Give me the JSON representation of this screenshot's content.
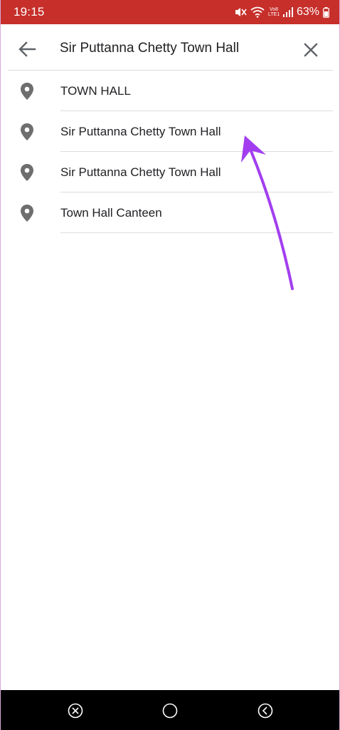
{
  "status_bar": {
    "time": "19:15",
    "network_label_top": "Vo8",
    "network_label_bottom": "LTE1",
    "battery": "63%",
    "color": "#c62f2a"
  },
  "search": {
    "query": "Sir Puttanna Chetty Town Hall",
    "back_icon": "arrow-left-icon",
    "clear_icon": "close-icon"
  },
  "results": [
    {
      "label": "TOWN HALL",
      "icon": "map-pin-icon"
    },
    {
      "label": "Sir Puttanna Chetty Town Hall",
      "icon": "map-pin-icon"
    },
    {
      "label": "Sir Puttanna Chetty Town Hall",
      "icon": "map-pin-icon"
    },
    {
      "label": "Town Hall Canteen",
      "icon": "map-pin-icon"
    }
  ],
  "annotation": {
    "color": "#a23ef0",
    "points_to": "results.1"
  },
  "nav_bar": {
    "icons": [
      "recent-apps-icon",
      "home-icon",
      "back-icon"
    ]
  }
}
